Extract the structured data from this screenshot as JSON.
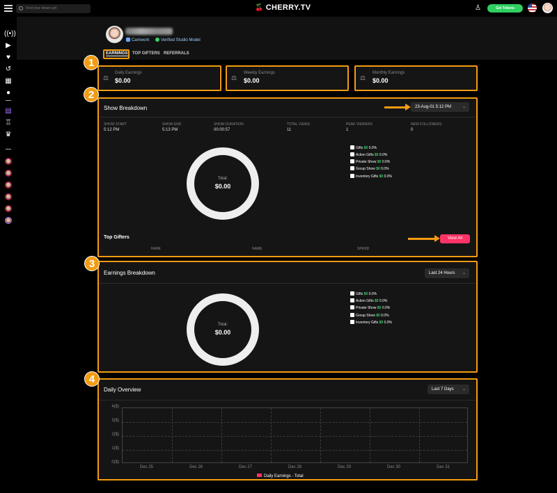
{
  "topbar": {
    "search_placeholder": "Find your dream girl",
    "logo_text": "CHERRY.TV",
    "get_tokens_label": "Get Tokens"
  },
  "sidebar": {
    "icons": [
      "broadcast-icon",
      "play-icon",
      "heart-icon",
      "history-icon",
      "grid-icon",
      "cherry-icon",
      "calendar-icon",
      "trophy-icon",
      "crown-icon"
    ],
    "avatar_count": 6
  },
  "profile": {
    "tags": [
      "Camwork",
      "Verified Studio Model"
    ]
  },
  "tabs": [
    "EARNINGS",
    "TOP GIFTERS",
    "REFERRALS"
  ],
  "active_tab": "EARNINGS",
  "summary": [
    {
      "label": "Daily Earnings",
      "value": "$0.00"
    },
    {
      "label": "Weekly Earnings",
      "value": "$0.00"
    },
    {
      "label": "Monthly Earnings",
      "value": "$0.00"
    }
  ],
  "callouts": [
    "1",
    "2",
    "3",
    "4"
  ],
  "show_breakdown": {
    "title": "Show Breakdown",
    "dropdown": "23-Aug-01 5:12 PM",
    "columns": [
      {
        "header": "SHOW START",
        "value": "5:12 PM"
      },
      {
        "header": "SHOW END",
        "value": "5:13 PM"
      },
      {
        "header": "SHOW DURATION",
        "value": "00:00:57"
      },
      {
        "header": "TOTAL VIEWS",
        "value": "11"
      },
      {
        "header": "PEAK VIEWERS",
        "value": "1"
      },
      {
        "header": "NEW FOLLOWERS",
        "value": "0"
      }
    ],
    "donut_label": "Total:",
    "donut_value": "$0.00",
    "legend": [
      {
        "name": "Gifts",
        "amount": "$0",
        "pct": "0.0%"
      },
      {
        "name": "Action Gifts",
        "amount": "$0",
        "pct": "0.0%"
      },
      {
        "name": "Private Show",
        "amount": "$0",
        "pct": "0.0%"
      },
      {
        "name": "Group Show",
        "amount": "$0",
        "pct": "0.0%"
      },
      {
        "name": "Inventory Gifts",
        "amount": "$0",
        "pct": "0.0%"
      }
    ],
    "top_gifters_title": "Top Gifters",
    "view_all_label": "View All",
    "gifter_columns": [
      "RANK",
      "NAME",
      "SPEND"
    ]
  },
  "earnings_breakdown": {
    "title": "Earnings Breakdown",
    "dropdown": "Last 24 Hours",
    "donut_label": "Total:",
    "donut_value": "$0.00",
    "legend": [
      {
        "name": "Gifts",
        "amount": "$0",
        "pct": "0.0%"
      },
      {
        "name": "Action Gifts",
        "amount": "$0",
        "pct": "0.0%"
      },
      {
        "name": "Private Show",
        "amount": "$0",
        "pct": "0.0%"
      },
      {
        "name": "Group Show",
        "amount": "$0",
        "pct": "0.0%"
      },
      {
        "name": "Inventory Gifts",
        "amount": "$0",
        "pct": "0.0%"
      }
    ]
  },
  "daily_overview": {
    "title": "Daily Overview",
    "dropdown": "Last 7 Days"
  },
  "colors": {
    "accent": "#f39c12",
    "pink": "#ff3366",
    "green": "#3ad16b",
    "panel": "#151515"
  },
  "chart_data": {
    "type": "bar",
    "categories": [
      "Dec 25",
      "Dec 26",
      "Dec 27",
      "Dec 28",
      "Dec 29",
      "Dec 30",
      "Dec 31"
    ],
    "series": [
      {
        "name": "Daily Earnings - Total",
        "values": [
          0,
          0,
          0,
          0,
          0,
          0,
          0
        ]
      }
    ],
    "yticks": [
      "4($)",
      "3($)",
      "2($)",
      "1($)",
      "0($)"
    ],
    "ylim": [
      0,
      4
    ],
    "grid": true,
    "legend_position": "bottom"
  }
}
